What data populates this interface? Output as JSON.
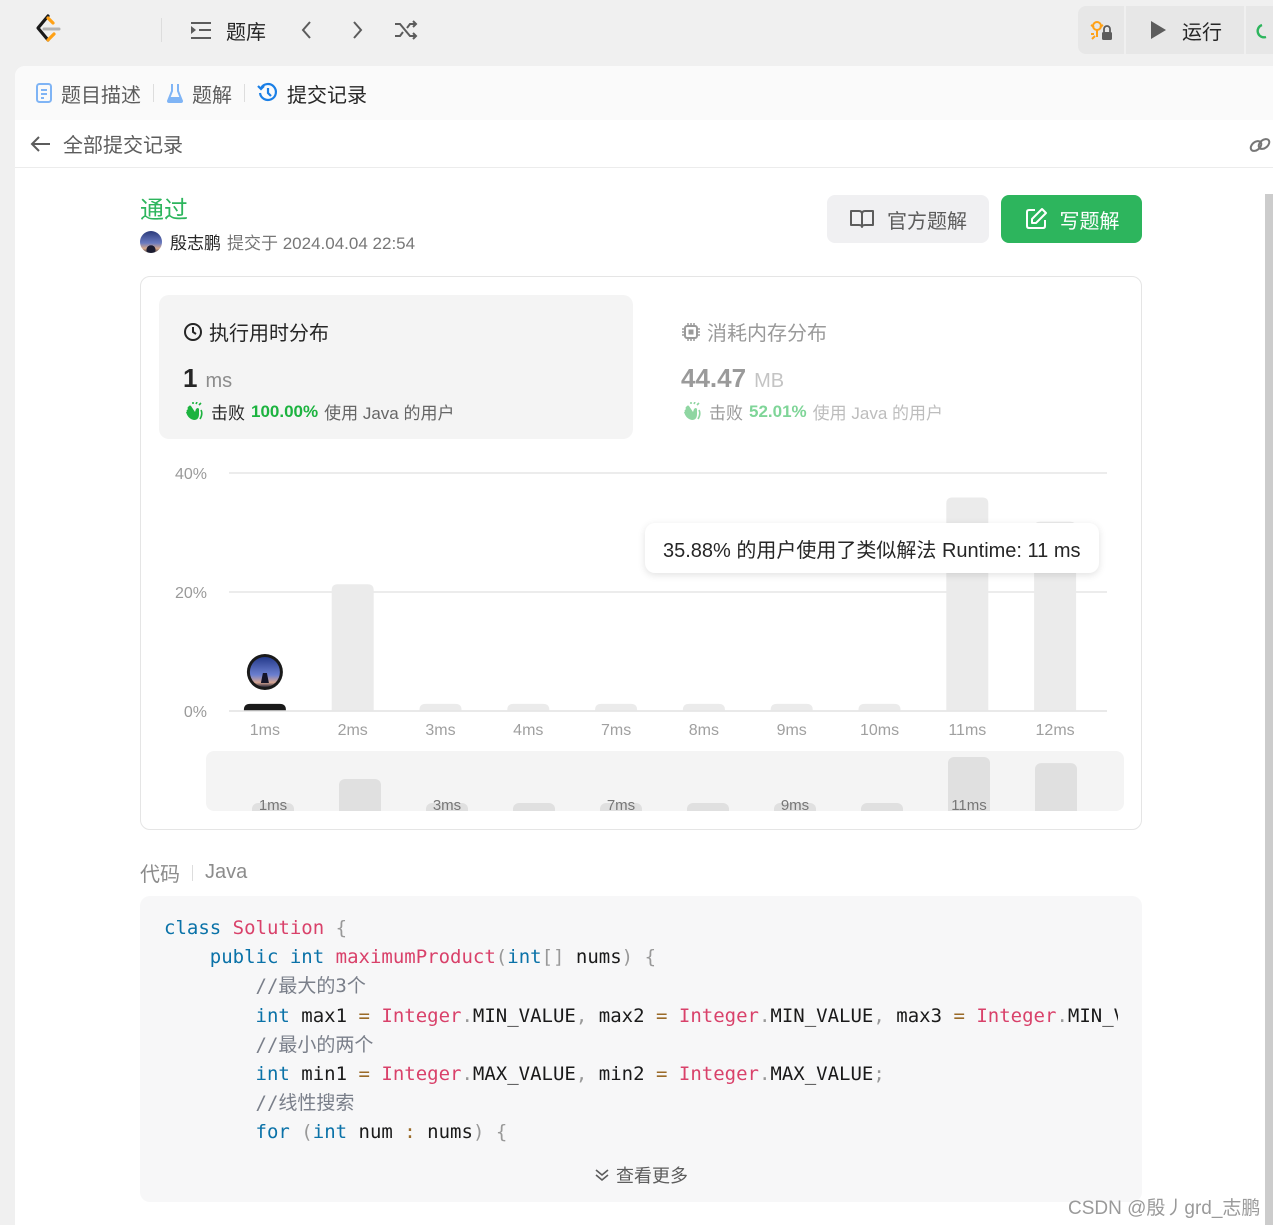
{
  "topbar": {
    "problem_list_label": "题库",
    "run_label": "运行"
  },
  "tabs": [
    {
      "label": "题目描述",
      "icon": "document-icon",
      "active": false
    },
    {
      "label": "题解",
      "icon": "flask-icon",
      "active": false
    },
    {
      "label": "提交记录",
      "icon": "history-icon",
      "active": true
    }
  ],
  "subheader": {
    "title": "全部提交记录"
  },
  "submission": {
    "status": "通过",
    "username": "殷志鹏",
    "submitted_text": "提交于 2024.04.04 22:54",
    "official_solution_label": "官方题解",
    "write_solution_label": "写题解"
  },
  "runtime": {
    "title": "执行用时分布",
    "value": "1",
    "unit": "ms",
    "beat_label": "击败",
    "beat_pct": "100.00%",
    "beat_rest": "使用 Java 的用户"
  },
  "memory": {
    "title": "消耗内存分布",
    "value": "44.47",
    "unit": "MB",
    "beat_label": "击败",
    "beat_pct": "52.01%",
    "beat_rest": "使用 Java 的用户"
  },
  "chart_data": {
    "type": "bar",
    "title": "执行用时分布",
    "xlabel": "",
    "ylabel": "",
    "categories": [
      "1ms",
      "2ms",
      "3ms",
      "4ms",
      "7ms",
      "8ms",
      "9ms",
      "10ms",
      "11ms",
      "12ms"
    ],
    "values": [
      1.2,
      21.3,
      1.2,
      1.2,
      1.2,
      1.2,
      1.2,
      1.2,
      35.88,
      31.8
    ],
    "highlight_index": 0,
    "yticks": [
      "0%",
      "20%",
      "40%"
    ],
    "ylim": [
      0,
      40
    ],
    "grid": true,
    "brush_labels": [
      "1ms",
      "3ms",
      "7ms",
      "9ms",
      "11ms"
    ],
    "tooltip": "35.88% 的用户使用了类似解法 Runtime: 11 ms"
  },
  "colors": {
    "accent_green": "#2db55d",
    "beat_green": "#1cb33f",
    "bar_gray": "#ebebeb",
    "bar_highlight": "#1a1a1a"
  },
  "code": {
    "label": "代码",
    "language": "Java",
    "show_more_label": "查看更多"
  },
  "watermark": "CSDN @殷丿grd_志鹏"
}
